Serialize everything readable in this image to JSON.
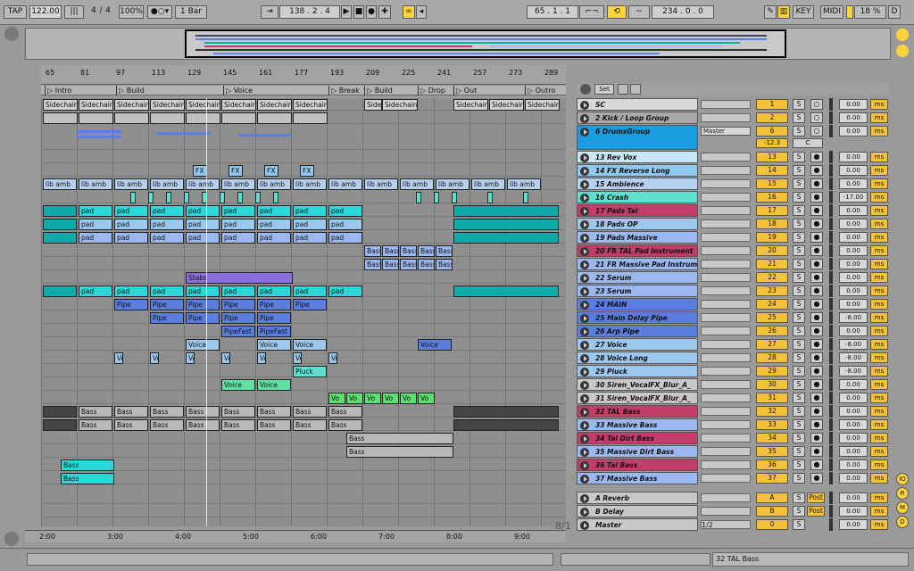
{
  "transport": {
    "tap": "TAP",
    "tempo": "122.00",
    "sig_num": "4",
    "sig_sep": "/",
    "sig_den": "4",
    "zoom": "100%",
    "quantize": "1 Bar",
    "position": "138 . 2 . 4",
    "loop_start": "65 . 1 . 1",
    "loop_length": "234 . 0 . 0",
    "key": "KEY",
    "midi": "MIDI",
    "cpu": "18 %",
    "disk": "D"
  },
  "ruler": {
    "bars": [
      "65",
      "81",
      "97",
      "113",
      "129",
      "145",
      "161",
      "177",
      "193",
      "209",
      "225",
      "241",
      "257",
      "273",
      "289"
    ]
  },
  "locators": [
    {
      "label": "Intro"
    },
    {
      "label": "Build"
    },
    {
      "label": "Voice"
    },
    {
      "label": "Break"
    },
    {
      "label": "Build"
    },
    {
      "label": "Drop"
    },
    {
      "label": "Out"
    },
    {
      "label": "Outro"
    }
  ],
  "time_ruler": [
    "2:00",
    "3:00",
    "4:00",
    "5:00",
    "6:00",
    "7:00",
    "8:00",
    "9:00"
  ],
  "time_sig_label": "8/1",
  "mixer_head": {
    "set_label": "Set"
  },
  "tracks": [
    {
      "name": "SC",
      "num": "1",
      "color": "#d8d8d8",
      "vol": "0.00",
      "arm": "○"
    },
    {
      "name": "2 Kick / Loop Group",
      "num": "2",
      "color": "#a9a9a9",
      "vol": "0.00",
      "arm": "○"
    },
    {
      "name": "6 DrumsGroup",
      "num": "6",
      "color": "#1a9de0",
      "vol": "0.00",
      "arm": "○",
      "route": "Master",
      "pan": "-12.3",
      "panc": "C"
    },
    {
      "name": "13 Rev Vox",
      "num": "13",
      "color": "#c8e8f8",
      "vol": "0.00",
      "arm": "●"
    },
    {
      "name": "14 FX Reverse Long",
      "num": "14",
      "color": "#8fc8f0",
      "vol": "0.00",
      "arm": "●"
    },
    {
      "name": "15 Ambience",
      "num": "15",
      "color": "#b8d0f0",
      "vol": "0.00",
      "arm": "●"
    },
    {
      "name": "16 Crash",
      "num": "16",
      "color": "#5ee0d0",
      "vol": "-17.00",
      "arm": "●"
    },
    {
      "name": "17 Pads Tal",
      "num": "17",
      "color": "#c43c6c",
      "vol": "0.00",
      "arm": "●"
    },
    {
      "name": "18 Pads OP",
      "num": "18",
      "color": "#9cc8f0",
      "vol": "0.00",
      "arm": "●"
    },
    {
      "name": "19 Pads Massive",
      "num": "19",
      "color": "#9cb8f0",
      "vol": "0.00",
      "arm": "●"
    },
    {
      "name": "20 FR TAL Pad Instrument",
      "num": "20",
      "color": "#c43c6c",
      "vol": "0.00",
      "arm": "●"
    },
    {
      "name": "21 FR Massive Pad Instrum",
      "num": "21",
      "color": "#9cb8f0",
      "vol": "0.00",
      "arm": "●"
    },
    {
      "name": "22 Serum",
      "num": "22",
      "color": "#9cb8f0",
      "vol": "0.00",
      "arm": "●"
    },
    {
      "name": "23 Serum",
      "num": "23",
      "color": "#9cb8f0",
      "vol": "0.00",
      "arm": "●"
    },
    {
      "name": "24 MAIN",
      "num": "24",
      "color": "#5a7ee0",
      "vol": "0.00",
      "arm": "●"
    },
    {
      "name": "25 Main Delay Pipe",
      "num": "25",
      "color": "#5a7ee0",
      "vol": "-8.00",
      "arm": "●"
    },
    {
      "name": "26 Arp Pipe",
      "num": "26",
      "color": "#5a7ee0",
      "vol": "0.00",
      "arm": "●"
    },
    {
      "name": "27 Voice",
      "num": "27",
      "color": "#9cc8f0",
      "vol": "-8.00",
      "arm": "●"
    },
    {
      "name": "28 Voice Long",
      "num": "28",
      "color": "#9cc8f0",
      "vol": "-8.00",
      "arm": "●"
    },
    {
      "name": "29 Pluck",
      "num": "29",
      "color": "#9cc8f0",
      "vol": "-8.00",
      "arm": "●"
    },
    {
      "name": "30 Siren_VocalFX_Blur_A_",
      "num": "30",
      "color": "#c8c8c8",
      "vol": "0.00",
      "arm": "●"
    },
    {
      "name": "31 Siren_VocalFX_Blur_A_",
      "num": "31",
      "color": "#c8c8c8",
      "vol": "0.00",
      "arm": "●"
    },
    {
      "name": "32 TAL Bass",
      "num": "32",
      "color": "#c43c6c",
      "vol": "0.00",
      "arm": "●"
    },
    {
      "name": "33 Massive Bass",
      "num": "33",
      "color": "#9cb8f0",
      "vol": "0.00",
      "arm": "●"
    },
    {
      "name": "34 Tal Dirt Bass",
      "num": "34",
      "color": "#c43c6c",
      "vol": "0.00",
      "arm": "●"
    },
    {
      "name": "35 Massive Dirt Bass",
      "num": "35",
      "color": "#9cb8f0",
      "vol": "0.00",
      "arm": "●"
    },
    {
      "name": "36 Tal Bass",
      "num": "36",
      "color": "#c43c6c",
      "vol": "0.00",
      "arm": "●"
    },
    {
      "name": "37 Massive Bass",
      "num": "37",
      "color": "#9cb8f0",
      "vol": "0.00",
      "arm": "●"
    }
  ],
  "returns": [
    {
      "name": "A Reverb",
      "num": "A",
      "post": "Post",
      "vol": "0.00"
    },
    {
      "name": "B Delay",
      "num": "B",
      "post": "Post",
      "vol": "0.00"
    },
    {
      "name": "Master",
      "num": "0",
      "post": "",
      "vol": "0.00",
      "route": "1/2"
    }
  ],
  "ms_label": "ms",
  "solo_label": "S",
  "rightrail": [
    "IO",
    "R",
    "M",
    "D"
  ],
  "status": {
    "selected_track": "32 TAL Bass"
  },
  "colors": {
    "accent": "#ffd43a",
    "cyan": "#00e0e0",
    "selection": "#f3c23a"
  }
}
